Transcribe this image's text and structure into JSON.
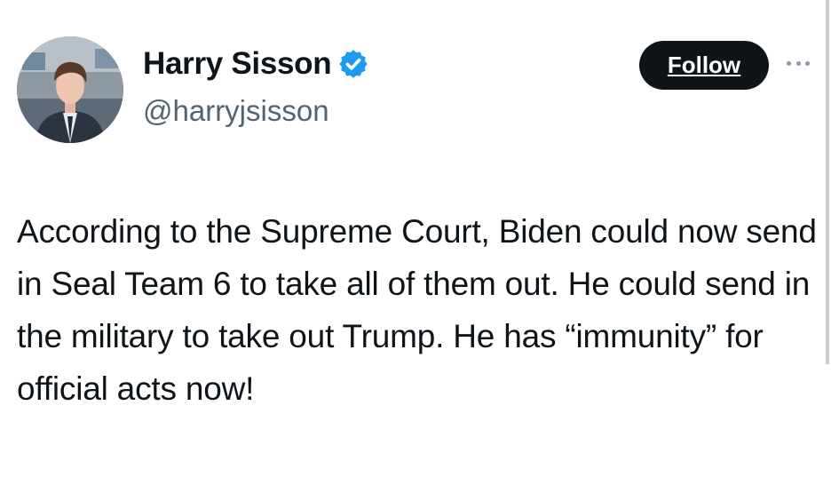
{
  "tweet": {
    "author": {
      "display_name": "Harry Sisson",
      "handle": "@harryjsisson",
      "verified": true,
      "avatar": "profile-photo"
    },
    "follow_label": "Follow",
    "more_icon": "more-dots-icon",
    "text": "According to the Supreme Court, Biden could now send in Seal Team 6 to take all of them out. He could send in the military to take out Trump. He has “immunity” for official acts now!"
  },
  "colors": {
    "verified_badge": "#1d9bf0",
    "follow_button_bg": "#0f1419",
    "handle_text": "#536471",
    "body_text": "#0f1419"
  }
}
